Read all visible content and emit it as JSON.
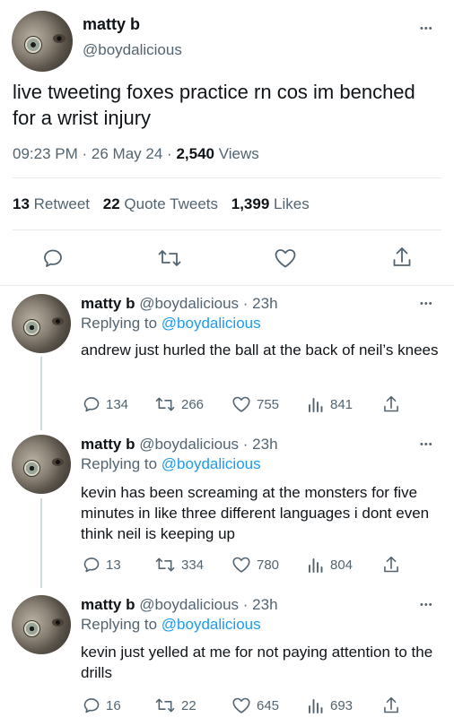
{
  "main_tweet": {
    "display_name": "matty b",
    "handle": "@boydalicious",
    "text": "live tweeting foxes practice rn cos im benched for a wrist injury",
    "time": "09:23 PM",
    "date": "26 May 24",
    "views_count": "2,540",
    "views_label": "Views",
    "retweets_count": "13",
    "retweets_label": "Retweet",
    "quotes_count": "22",
    "quotes_label": "Quote Tweets",
    "likes_count": "1,399",
    "likes_label": "Likes",
    "more_label": "•••",
    "icons": [
      "reply-icon",
      "retweet-icon",
      "like-icon",
      "share-icon"
    ]
  },
  "replies": [
    {
      "display_name": "matty b",
      "handle": "@boydalicious",
      "age": "23h",
      "replying_label": "Replying to",
      "replying_to": "@boydalicious",
      "text": "andrew just hurled the ball at the back of neil’s knees",
      "reply_count": "134",
      "retweet_count": "266",
      "like_count": "755",
      "view_count": "841"
    },
    {
      "display_name": "matty b",
      "handle": "@boydalicious",
      "age": "23h",
      "replying_label": "Replying to",
      "replying_to": "@boydalicious",
      "text": "kevin has been screaming at the monsters for five minutes in like three different languages i dont even think neil is keeping up",
      "reply_count": "13",
      "retweet_count": "334",
      "like_count": "780",
      "view_count": "804"
    },
    {
      "display_name": "matty b",
      "handle": "@boydalicious",
      "age": "23h",
      "replying_label": "Replying to",
      "replying_to": "@boydalicious",
      "text": "kevin just yelled at me for not paying attention to the drills",
      "reply_count": "16",
      "retweet_count": "22",
      "like_count": "645",
      "view_count": "693"
    }
  ],
  "separators": {
    "dot": "·"
  },
  "colors": {
    "link": "#1d9bf0",
    "muted": "#536471",
    "text": "#0f1419",
    "divider": "#e7e9ea"
  }
}
